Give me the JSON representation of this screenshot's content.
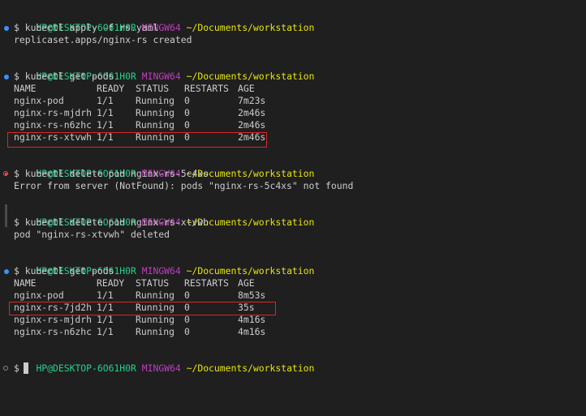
{
  "prompt": {
    "user_host": "HP@DESKTOP-6O61H0R",
    "shell": "MINGW64",
    "path": "~/Documents/workstation",
    "symbol": "$"
  },
  "blocks": [
    {
      "command": "kubectl apply -f rs.yaml",
      "status": "success",
      "output": [
        "replicaset.apps/nginx-rs created"
      ]
    },
    {
      "command": "kubectl get pods",
      "status": "success",
      "table": {
        "headers": [
          "NAME",
          "READY",
          "STATUS",
          "RESTARTS",
          "AGE"
        ],
        "rows": [
          [
            "nginx-pod",
            "1/1",
            "Running",
            "0",
            "7m23s"
          ],
          [
            "nginx-rs-mjdrh",
            "1/1",
            "Running",
            "0",
            "2m46s"
          ],
          [
            "nginx-rs-n6zhc",
            "1/1",
            "Running",
            "0",
            "2m46s"
          ],
          [
            "nginx-rs-xtvwh",
            "1/1",
            "Running",
            "0",
            "2m46s"
          ]
        ],
        "highlighted_row": 3
      }
    },
    {
      "command": "kubectl delete pod nginx-rs-5c4xs",
      "status": "error",
      "output": [
        "Error from server (NotFound): pods \"nginx-rs-5c4xs\" not found"
      ]
    },
    {
      "command": "kubectl delete pod nginx-rs-xtvwh",
      "status": "neutral",
      "output": [
        "pod \"nginx-rs-xtvwh\" deleted"
      ]
    },
    {
      "command": "kubectl get pods",
      "status": "success",
      "table": {
        "headers": [
          "NAME",
          "READY",
          "STATUS",
          "RESTARTS",
          "AGE"
        ],
        "rows": [
          [
            "nginx-pod",
            "1/1",
            "Running",
            "0",
            "8m53s"
          ],
          [
            "nginx-rs-7jd2h",
            "1/1",
            "Running",
            "0",
            "35s"
          ],
          [
            "nginx-rs-mjdrh",
            "1/1",
            "Running",
            "0",
            "4m16s"
          ],
          [
            "nginx-rs-n6zhc",
            "1/1",
            "Running",
            "0",
            "4m16s"
          ]
        ],
        "highlighted_row": 1
      }
    }
  ],
  "colors": {
    "background": "#1f1f1f",
    "foreground": "#cccccc",
    "user_host": "#23d18b",
    "shell": "#bc3fbc",
    "path": "#e5e510",
    "success_dot": "#3794ff",
    "error_dot": "#f14c4c",
    "highlight_box": "#e02424"
  }
}
